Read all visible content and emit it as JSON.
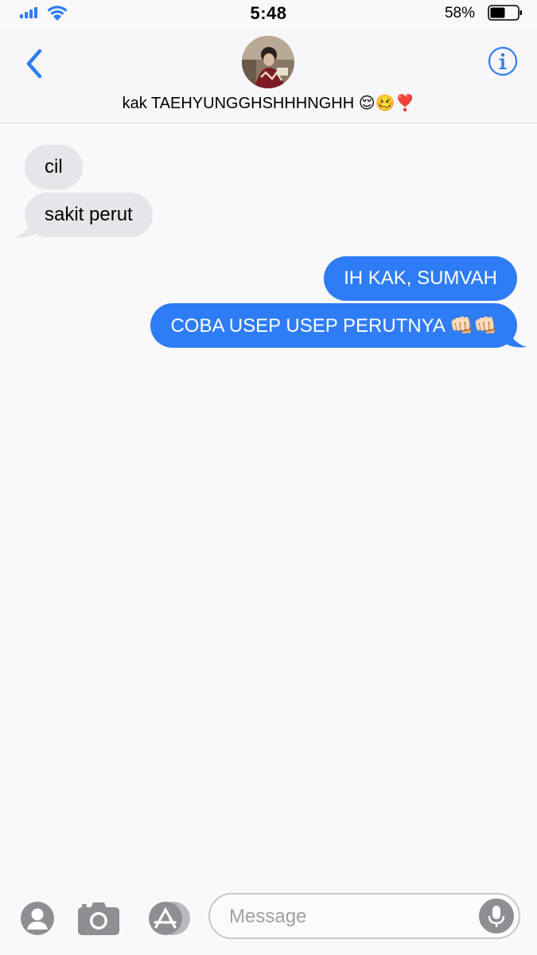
{
  "status_bar": {
    "time": "5:48",
    "battery_percent": "58%",
    "battery_level": 0.58,
    "accent_color": "#2f7cf6"
  },
  "header": {
    "contact_name": "kak TAEHYUNGGHSHHHNGHH",
    "contact_emoji": "😌🥴❣️",
    "back_icon": "chevron-left-icon",
    "info_icon": "info-icon"
  },
  "messages": [
    {
      "direction": "received",
      "text": "cil"
    },
    {
      "direction": "received",
      "text": "sakit perut"
    },
    {
      "direction": "sent",
      "text": "IH KAK, SUMVAH"
    },
    {
      "direction": "sent",
      "text": "COBA USEP USEP PERUTNYA",
      "emoji": "👊🏻👊🏻"
    }
  ],
  "input_bar": {
    "placeholder": "Message",
    "icons": [
      "contact-icon",
      "camera-icon",
      "app-store-icon",
      "mic-icon"
    ]
  },
  "colors": {
    "sent_bubble": "#2e7cf6",
    "received_bubble": "#e5e5ea",
    "background": "#f9f9fb"
  }
}
